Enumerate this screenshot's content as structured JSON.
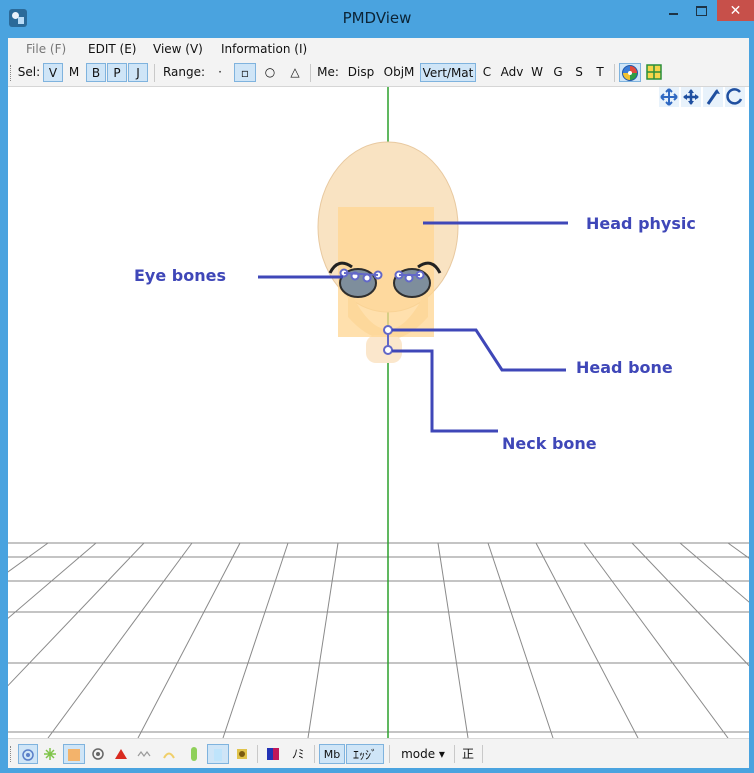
{
  "window": {
    "title": "PMDView"
  },
  "menubar": {
    "file": "File (F)",
    "edit": "EDIT (E)",
    "view": "View (V)",
    "information": "Information (I)"
  },
  "toolbar": {
    "sel_label": "Sel:",
    "sel_v": "V",
    "sel_m": "M",
    "sel_b": "B",
    "sel_p": "P",
    "sel_j": "J",
    "range_label": "Range:",
    "range_dot": "·",
    "range_square": "▫",
    "range_circle": "○",
    "range_triangle": "△",
    "me_label": "Me:",
    "disp": "Disp",
    "objm": "ObjM",
    "vertmat": "Vert/Mat",
    "c": "C",
    "adv": "Adv",
    "w": "W",
    "g": "G",
    "s": "S",
    "t": "T"
  },
  "annotations": {
    "head_physic": "Head physic",
    "eye_bones": "Eye bones",
    "head_bone": "Head bone",
    "neck_bone": "Neck bone"
  },
  "bottombar": {
    "nomi_label": "ﾉﾐ",
    "mb_label": "Mb",
    "edge_label": "ｴｯｼﾞ",
    "mode_label": "mode ▾",
    "sei_label": "正"
  },
  "colors": {
    "titlebar": "#4aa3df",
    "close_button": "#c7504a",
    "annotation": "#3f47b8",
    "axis_line": "#2ca02c",
    "toggle_on": "#cfe5f7"
  }
}
